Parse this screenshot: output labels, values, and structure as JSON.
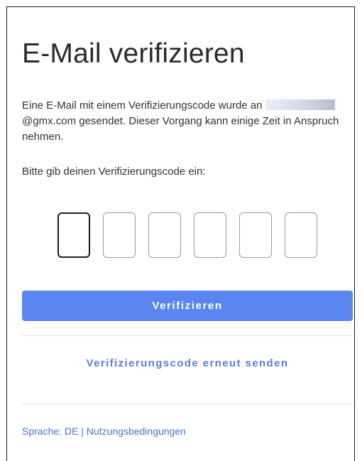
{
  "page": {
    "title": "E-Mail verifizieren",
    "description_before": "Eine E-Mail mit einem Verifizierungscode wurde an",
    "email_domain_text": "@gmx.com gesendet. Dieser Vorgang kann einige Zeit in Anspruch nehmen.",
    "prompt": "Bitte gib deinen Verifizierungscode ein:"
  },
  "code_inputs": {
    "count": 6,
    "values": [
      "",
      "",
      "",
      "",
      "",
      ""
    ],
    "active_index": 0
  },
  "buttons": {
    "verify_label": "Verifizieren",
    "resend_label": "Verifizierungscode erneut senden"
  },
  "footer": {
    "language_label": "Sprache: DE",
    "separator": "|",
    "terms_label": "Nutzungsbedingungen"
  },
  "colors": {
    "accent": "#5b86f0",
    "link": "#4a72d6"
  }
}
